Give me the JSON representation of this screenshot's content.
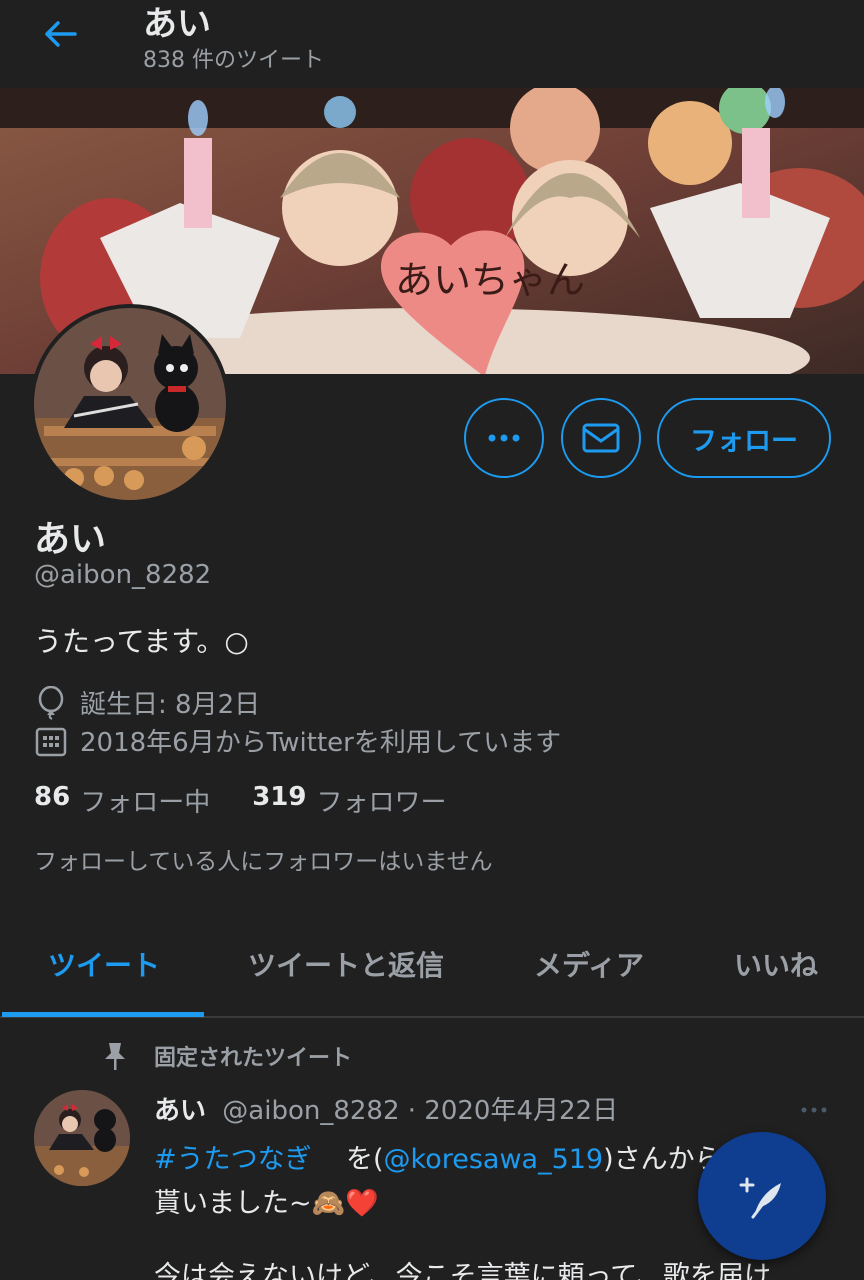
{
  "header": {
    "title": "あい",
    "subtitle": "838 件のツイート",
    "back_icon": "arrow-left-icon"
  },
  "profile": {
    "display_name": "あい",
    "handle": "@aibon_8282",
    "bio": "うたってます。○",
    "birthday": "誕生日: 8月2日",
    "joined": "2018年6月からTwitterを利用しています",
    "following_count": "86",
    "following_label": "フォロー中",
    "followers_count": "319",
    "followers_label": "フォロワー",
    "followers_note": "フォローしている人にフォロワーはいません",
    "follow_button": "フォロー",
    "banner_text": "あいちゃん"
  },
  "tabs": [
    {
      "label": "ツイート",
      "active": true
    },
    {
      "label": "ツイートと返信",
      "active": false
    },
    {
      "label": "メディア",
      "active": false
    },
    {
      "label": "いいね",
      "active": false
    }
  ],
  "pinned_tweet": {
    "pinned_label": "固定されたツイート",
    "name": "あい",
    "handle": "@aibon_8282",
    "separator": "·",
    "date": "2020年4月22日",
    "hashtag": "#うたつなぎ",
    "text_a": "を(",
    "mention": "@koresawa_519",
    "text_b": ")さんから",
    "line2": "貰いました~🙈❤️",
    "line3": "今は会えないけど、今こそ言葉に頼って、歌を届け"
  },
  "colors": {
    "background": "#202020",
    "accent": "#1d9bf0",
    "secondary_text": "#9aa0a6",
    "fab": "#0f3d8f"
  }
}
